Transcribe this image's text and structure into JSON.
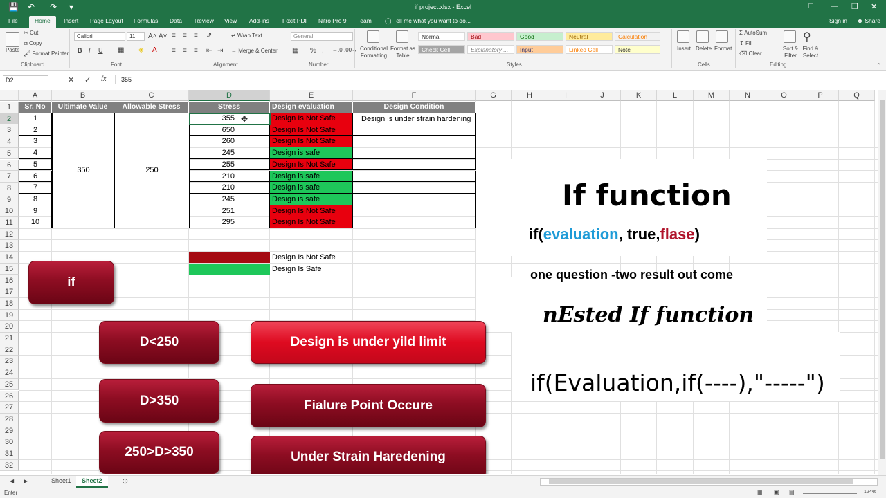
{
  "window": {
    "title": "if project.xlsx - Excel",
    "signin": "Sign in",
    "share": "Share"
  },
  "ribbon_tabs": [
    "File",
    "Home",
    "Insert",
    "Page Layout",
    "Formulas",
    "Data",
    "Review",
    "View",
    "Add-ins",
    "Foxit PDF",
    "Nitro Pro 9",
    "Team"
  ],
  "tell_me": "Tell me what you want to do...",
  "clipboard": {
    "paste": "Paste",
    "cut": "Cut",
    "copy": "Copy",
    "format_painter": "Format Painter",
    "group": "Clipboard"
  },
  "font": {
    "name": "Calibri",
    "size": "11",
    "group": "Font"
  },
  "alignment": {
    "wrap": "Wrap Text",
    "merge": "Merge & Center",
    "group": "Alignment"
  },
  "number": {
    "format": "General",
    "group": "Number"
  },
  "styles": {
    "cond": "Conditional Formatting",
    "fmt_table": "Format as Table",
    "cells": [
      "Normal",
      "Bad",
      "Good",
      "Neutral",
      "Calculation",
      "Check Cell",
      "Explanatory ...",
      "Input",
      "Linked Cell",
      "Note"
    ],
    "group": "Styles"
  },
  "cells_group": {
    "insert": "Insert",
    "delete": "Delete",
    "format": "Format",
    "group": "Cells"
  },
  "editing": {
    "autosum": "AutoSum",
    "fill": "Fill",
    "clear": "Clear",
    "sort": "Sort & Filter",
    "find": "Find & Select",
    "group": "Editing"
  },
  "formula_bar": {
    "name_box": "D2",
    "value": "355"
  },
  "columns": [
    "A",
    "B",
    "C",
    "D",
    "E",
    "F",
    "G",
    "H",
    "I",
    "J",
    "K",
    "L",
    "M",
    "N",
    "O",
    "P",
    "Q"
  ],
  "rows": [
    "1",
    "2",
    "3",
    "4",
    "5",
    "6",
    "7",
    "8",
    "9",
    "10",
    "11",
    "12",
    "13",
    "14",
    "15",
    "16",
    "17",
    "18",
    "19",
    "20",
    "21",
    "22",
    "23",
    "24",
    "25",
    "26",
    "27",
    "28",
    "29",
    "30",
    "31",
    "32"
  ],
  "table": {
    "headers": [
      "Sr. No",
      "Ultimate Value",
      "Allowable Stress",
      "Stress",
      "Design evaluation",
      "Design Condition"
    ],
    "ultimate": "350",
    "allowable": "250",
    "sr": [
      "1",
      "2",
      "3",
      "4",
      "5",
      "6",
      "7",
      "8",
      "9",
      "10"
    ],
    "stress": [
      "355",
      "650",
      "260",
      "245",
      "255",
      "210",
      "210",
      "245",
      "251",
      "295"
    ],
    "evaluation": [
      "Design Is Not Safe",
      "Design Is Not Safe",
      "Design Is Not Safe",
      "Design is safe",
      "Design Is Not Safe",
      "Design is safe",
      "Design is safe",
      "Design is safe",
      "Design Is Not Safe",
      "Design Is Not Safe"
    ],
    "condition_row2": "Design is under strain hardening"
  },
  "legend": {
    "not_safe": "Design Is Not Safe",
    "safe": "Design Is Safe",
    "red": "#a50a12",
    "green": "#1ec75a"
  },
  "shapes": {
    "if_btn": "if",
    "d_lt": "D<250",
    "d_gt": "D>350",
    "d_between": "250>D>350",
    "yield": "Design is under yild limit",
    "failure": "Fialure Point Occure",
    "strain": "Under Strain Haredening"
  },
  "notes": {
    "title": "If function",
    "syntax_prefix": "if(",
    "syntax_eval": "evaluation",
    "syntax_mid": ", true,",
    "syntax_false": "flase",
    "syntax_end": ")",
    "one_question": "one question -two result out come",
    "nested": "nEsted If function",
    "nested_syntax": "if(Evaluation,if(----),\"-----\")"
  },
  "colors": {
    "eval_blue": "#1e9bd7",
    "false_red": "#b0132a",
    "excel_green": "#217346",
    "red_fill": "#e8000e",
    "green_fill": "#1ec75a"
  },
  "sheets": [
    "Sheet1",
    "Sheet2"
  ],
  "status": {
    "mode": "Enter",
    "zoom": "124%"
  }
}
